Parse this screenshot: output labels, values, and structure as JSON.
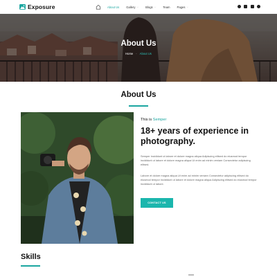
{
  "brand": {
    "name": "Exposure",
    "accent": "#1aa6a0"
  },
  "nav": {
    "items": [
      {
        "label": "About Us",
        "active": true,
        "dropdown": false
      },
      {
        "label": "Gallery",
        "active": false,
        "dropdown": true
      },
      {
        "label": "Blogs",
        "active": false,
        "dropdown": true
      },
      {
        "label": "Team",
        "active": false,
        "dropdown": false
      },
      {
        "label": "Pages",
        "active": false,
        "dropdown": true
      }
    ]
  },
  "social": [
    "facebook-icon",
    "instagram-icon",
    "linkedin-icon",
    "pinterest-icon"
  ],
  "hero": {
    "title": "About Us",
    "breadcrumb": {
      "home": "Home",
      "current": "About Us"
    }
  },
  "about": {
    "section_title": "About Us",
    "this_is": "This is",
    "this_is_accent": "Semper",
    "headline": "18+ years of experience in photography.",
    "para1": "Semper incididunt ut labore et dolore magna aliqua Adipiscing elitsed do eiusmod tempor incididunt ut labore et dolore magna aliqua Ut enim ad minim veniam Consectetur adipiscing elitsed.",
    "para2": "Labore et dolore magna aliqua Ut enim ad minim veniam Consectetur adipiscing elitsed do eiusmod tempor incididunt ut labore et dolore magna aliqua Adipiscing elitsed do eiusmod tempor incididunt ut labore.",
    "button": "CONTACT US"
  },
  "skills": {
    "title": "Skills"
  }
}
